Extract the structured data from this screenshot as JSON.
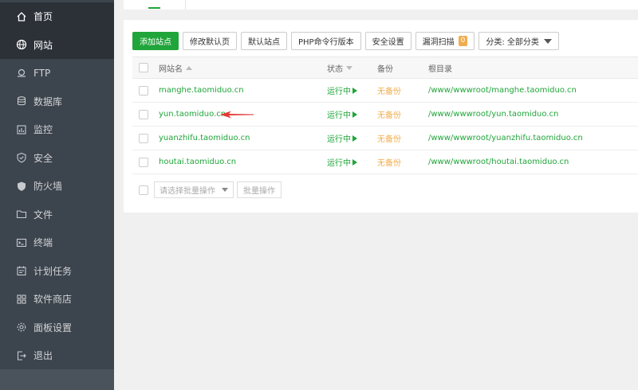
{
  "sidebar": {
    "items": [
      {
        "label": "首页",
        "icon": "home-icon",
        "key": "home"
      },
      {
        "label": "网站",
        "icon": "globe-icon",
        "key": "website"
      },
      {
        "label": "FTP",
        "icon": "ftp-icon",
        "key": "ftp"
      },
      {
        "label": "数据库",
        "icon": "database-icon",
        "key": "database"
      },
      {
        "label": "监控",
        "icon": "monitor-icon",
        "key": "monitor"
      },
      {
        "label": "安全",
        "icon": "shield-icon",
        "key": "security"
      },
      {
        "label": "防火墙",
        "icon": "firewall-icon",
        "key": "firewall"
      },
      {
        "label": "文件",
        "icon": "folder-icon",
        "key": "files"
      },
      {
        "label": "终端",
        "icon": "terminal-icon",
        "key": "terminal"
      },
      {
        "label": "计划任务",
        "icon": "calendar-icon",
        "key": "cron"
      },
      {
        "label": "软件商店",
        "icon": "grid-icon",
        "key": "store"
      },
      {
        "label": "面板设置",
        "icon": "gear-icon",
        "key": "settings"
      },
      {
        "label": "退出",
        "icon": "logout-icon",
        "key": "logout"
      }
    ],
    "active": "website"
  },
  "toolbar": {
    "add_site": "添加站点",
    "edit_default_page": "修改默认页",
    "default_site": "默认站点",
    "php_cli_version": "PHP命令行版本",
    "security_settings": "安全设置",
    "vuln_scan": "漏洞扫描",
    "vuln_scan_count": "0",
    "category_filter": "分类: 全部分类"
  },
  "table": {
    "headers": {
      "name": "网站名",
      "status": "状态",
      "backup": "备份",
      "root": "根目录"
    },
    "rows": [
      {
        "name": "manghe.taomiduo.cn",
        "status": "运行中",
        "backup": "无备份",
        "root": "/www/wwwroot/manghe.taomiduo.cn"
      },
      {
        "name": "yun.taomiduo.cn",
        "status": "运行中",
        "backup": "无备份",
        "root": "/www/wwwroot/yun.taomiduo.cn"
      },
      {
        "name": "yuanzhifu.taomiduo.cn",
        "status": "运行中",
        "backup": "无备份",
        "root": "/www/wwwroot/yuanzhifu.taomiduo.cn"
      },
      {
        "name": "houtai.taomiduo.cn",
        "status": "运行中",
        "backup": "无备份",
        "root": "/www/wwwroot/houtai.taomiduo.cn"
      }
    ]
  },
  "batch": {
    "select_placeholder": "请选择批量操作",
    "batch_button": "批量操作"
  },
  "colors": {
    "sidebar_bg": "#3c444d",
    "sidebar_active": "#2c3138",
    "accent_green": "#20a53a",
    "warning_orange": "#f0ad4e",
    "annotation_red": "#e53935"
  }
}
